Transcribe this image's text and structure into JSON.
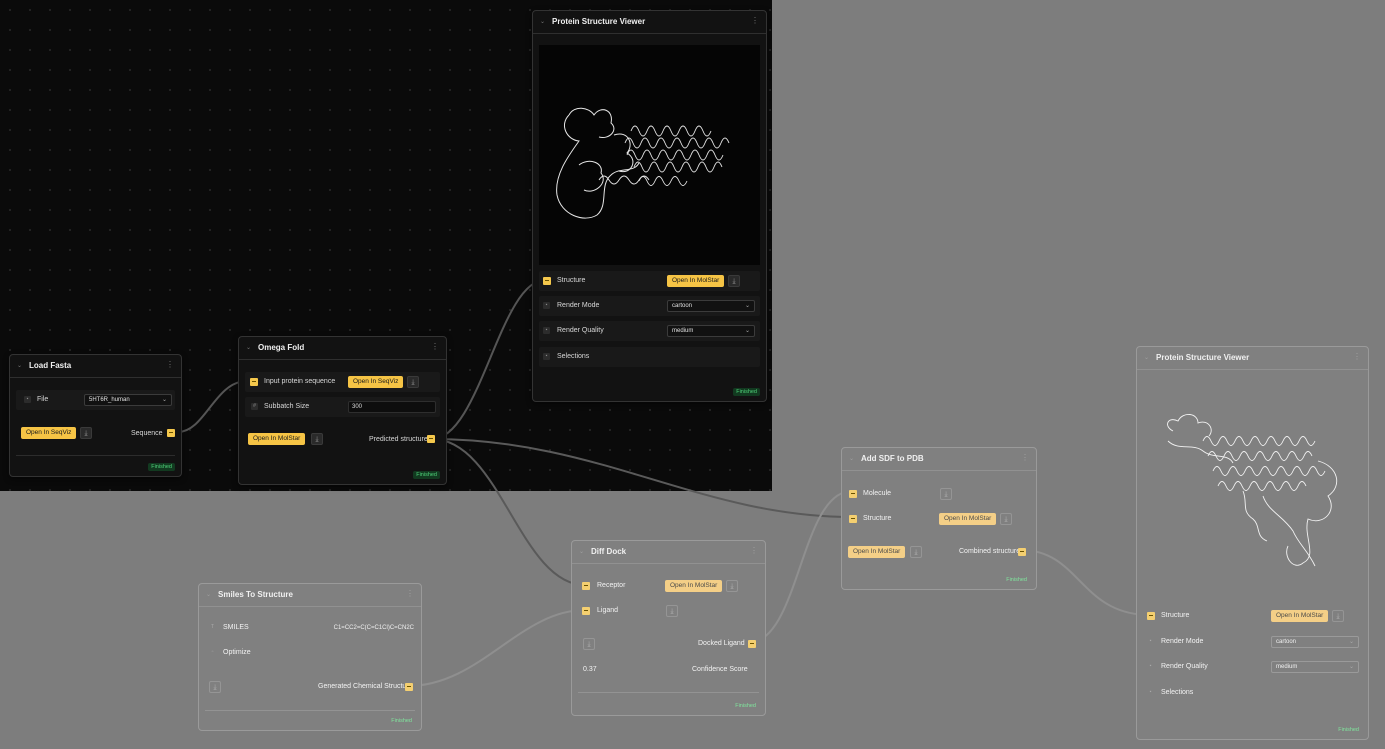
{
  "colors": {
    "port": "#f5c84c",
    "button": "#f6c445",
    "status": "#4fd27a",
    "canvas": "#0a0a0a",
    "backdrop": "#7d7d7d"
  },
  "load_fasta": {
    "title": "Load Fasta",
    "file_label": "File",
    "file_value": "5HT6R_human",
    "open_button": "Open In SeqViz",
    "sequence_label": "Sequence",
    "status": "Finished"
  },
  "omega_fold": {
    "title": "Omega Fold",
    "input_label": "Input protein sequence",
    "open_seqviz": "Open In SeqViz",
    "subbatch_label": "Subbatch Size",
    "subbatch_value": "300",
    "open_molstar": "Open In MolStar",
    "output_label": "Predicted structure",
    "status": "Finished"
  },
  "viewer_top": {
    "title": "Protein Structure Viewer",
    "structure_label": "Structure",
    "open_molstar": "Open In MolStar",
    "render_mode_label": "Render Mode",
    "render_mode_value": "cartoon",
    "render_quality_label": "Render Quality",
    "render_quality_value": "medium",
    "selections_label": "Selections",
    "status": "Finished"
  },
  "smiles": {
    "title": "Smiles To Structure",
    "smiles_label": "SMILES",
    "smiles_value": "C1=CC2=C(C=C1Cl)C=CN2C",
    "optimize_label": "Optimize",
    "output_label": "Generated Chemical Structure",
    "status": "Finished"
  },
  "diff_dock": {
    "title": "Diff Dock",
    "receptor_label": "Receptor",
    "open_molstar": "Open In MolStar",
    "ligand_label": "Ligand",
    "docked_label": "Docked Ligand",
    "confidence_value": "0.37",
    "confidence_label": "Confidence Score",
    "status": "Finished"
  },
  "add_sdf": {
    "title": "Add SDF to PDB",
    "molecule_label": "Molecule",
    "structure_label": "Structure",
    "open_molstar_1": "Open In MolStar",
    "open_molstar_2": "Open In MolStar",
    "combined_label": "Combined structure",
    "status": "Finished"
  },
  "viewer_right": {
    "title": "Protein Structure Viewer",
    "structure_label": "Structure",
    "open_molstar": "Open In MolStar",
    "render_mode_label": "Render Mode",
    "render_mode_value": "cartoon",
    "render_quality_label": "Render Quality",
    "render_quality_value": "medium",
    "selections_label": "Selections",
    "status": "Finished"
  }
}
